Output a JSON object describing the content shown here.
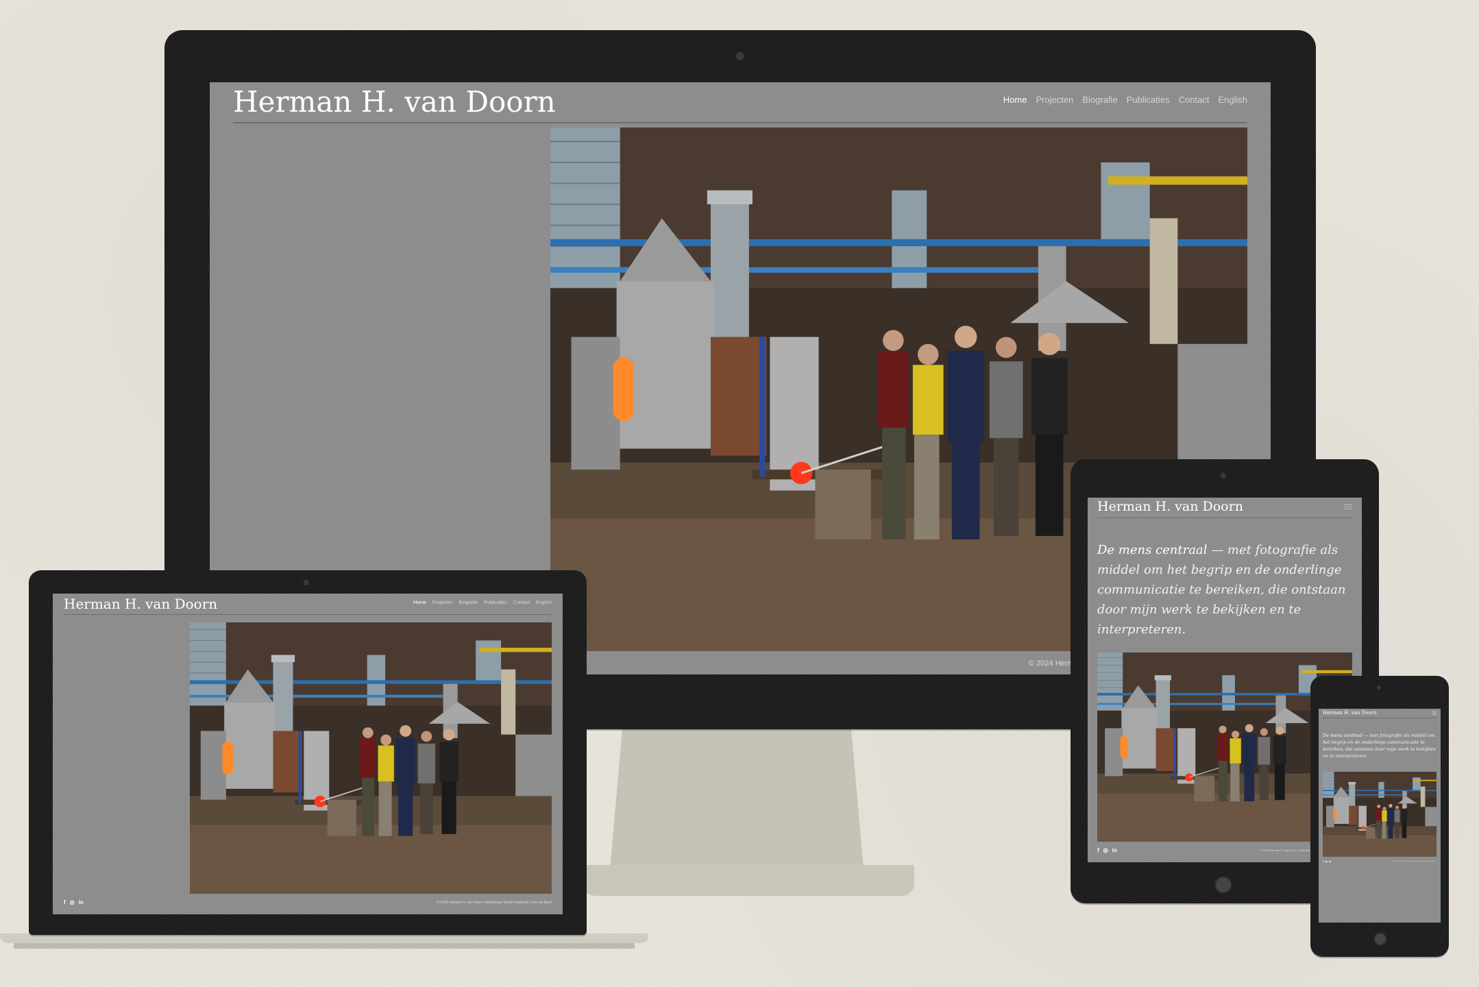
{
  "site": {
    "title": "Herman H. van Doorn",
    "nav": [
      "Home",
      "Projecten",
      "Biografie",
      "Publicaties",
      "Contact",
      "English"
    ],
    "active_nav": "Home",
    "intro_emphasis": "De mens centraal",
    "intro_rest": " — met fotografie als middel om het begrip en de onderlinge communicatie te bereiken, die ontstaan door mijn werk te bekijken en te interpreteren.",
    "footer_desktop": "© 2024 Herm",
    "footer_full": "© 2024 Herman H. van Doorn | Webdesign Studio Kwadraat | Foto de Boerl",
    "social": [
      "f",
      "◎",
      "in"
    ]
  },
  "colors": {
    "background": "#e8e4dc",
    "device_body": "#1b1b1b",
    "site_background": "#8d8d8d",
    "text": "#ffffff",
    "glow": "#ff3a1a"
  },
  "icons": [
    "camera-icon",
    "menu-icon",
    "facebook-icon",
    "instagram-icon",
    "linkedin-icon",
    "home-button-icon"
  ]
}
